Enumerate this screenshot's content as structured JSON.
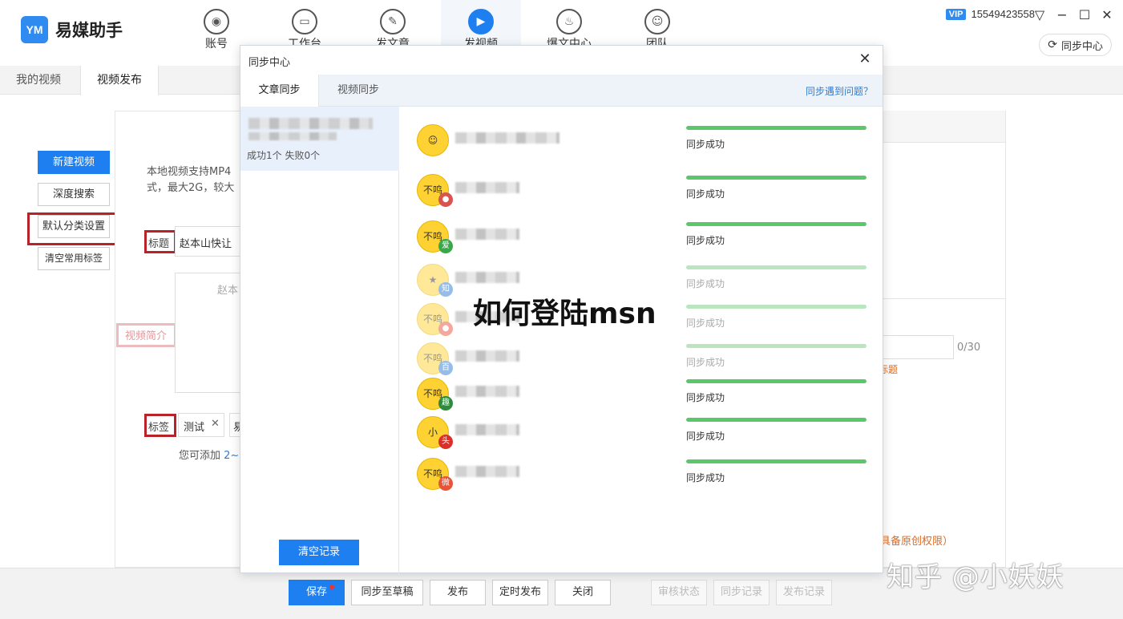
{
  "app": {
    "logo_mark": "YM",
    "name": "易媒助手",
    "nav": [
      {
        "label": "账号",
        "icon": "user-icon",
        "glyph": "◉"
      },
      {
        "label": "工作台",
        "icon": "monitor-icon",
        "glyph": "▭"
      },
      {
        "label": "发文章",
        "icon": "feather-icon",
        "glyph": "✎"
      },
      {
        "label": "发视频",
        "icon": "play-icon",
        "glyph": "▶"
      },
      {
        "label": "爆文中心",
        "icon": "flame-icon",
        "glyph": "♨"
      },
      {
        "label": "团队",
        "icon": "team-icon",
        "glyph": "☺"
      }
    ],
    "vip": "VIP",
    "phone": "15549423558",
    "sync_center_button": "同步中心"
  },
  "subtabs": [
    "我的视频",
    "视频发布"
  ],
  "left_buttons": {
    "new_video": "新建视频",
    "deep_search": "深度搜索",
    "default_category": "默认分类设置",
    "clear_tags": "清空常用标签"
  },
  "form": {
    "hint_line1": "本地视频支持MP4",
    "hint_line2": "式，最大2G，较大",
    "title_label": "标题",
    "title_value": "赵本山快让",
    "intro_label": "视频简介",
    "intro_placeholder": "赵本",
    "tags_label": "标签",
    "tag_1": "测试",
    "tag_2": "易",
    "tag_hint": "您可添加",
    "tag_hint_range": "2~",
    "counter": "0/30",
    "title_link": "标题",
    "original_note": "具备原创权限）"
  },
  "bottom_buttons": {
    "save": "保存",
    "sync_draft": "同步至草稿",
    "publish": "发布",
    "scheduled": "定时发布",
    "close": "关闭",
    "review_status": "审核状态",
    "sync_record": "同步记录",
    "publish_record": "发布记录"
  },
  "sync_modal": {
    "title": "同步中心",
    "tabs": [
      "文章同步",
      "视频同步"
    ],
    "help_link": "同步遇到问题？",
    "record_summary": "成功1个 失败0个",
    "clear_button": "清空记录",
    "rows": [
      {
        "avatar": "☺",
        "badge": "",
        "badge_color": "#ffffff",
        "status": "同步成功",
        "progress": 1.0,
        "faded": false
      },
      {
        "avatar": "不鸣",
        "badge": "●",
        "badge_color": "#d9534f",
        "status": "同步成功",
        "progress": 1.0,
        "faded": false
      },
      {
        "avatar": "不鸣",
        "badge": "爱",
        "badge_color": "#38a84a",
        "status": "同步成功",
        "progress": 1.0,
        "faded": false
      },
      {
        "avatar": "★",
        "badge": "知",
        "badge_color": "#2f7dd1",
        "status": "同步成功",
        "progress": 1.0,
        "faded": true
      },
      {
        "avatar": "不鸣",
        "badge": "●",
        "badge_color": "#e8543a",
        "status": "同步成功",
        "progress": 1.0,
        "faded": true
      },
      {
        "avatar": "不鸣",
        "badge": "百",
        "badge_color": "#2f7dd1",
        "status": "同步成功",
        "progress": 1.0,
        "faded": true
      },
      {
        "avatar": "不鸣",
        "badge": "趣",
        "badge_color": "#2e8b3e",
        "status": "同步成功",
        "progress": 1.0,
        "faded": false
      },
      {
        "avatar": "小",
        "badge": "头",
        "badge_color": "#d9302c",
        "status": "同步成功",
        "progress": 1.0,
        "faded": false
      },
      {
        "avatar": "不鸣",
        "badge": "微",
        "badge_color": "#e8543a",
        "status": "同步成功",
        "progress": 1.0,
        "faded": false
      }
    ]
  },
  "overlay_title": "如何登陆msn",
  "watermark": "知乎 @小妖妖",
  "colors": {
    "accent": "#1e7ff0",
    "success": "#5cc66a",
    "highlight_border": "#b8232a",
    "link": "#2f7dd1",
    "warning_link": "#e06a1f"
  }
}
